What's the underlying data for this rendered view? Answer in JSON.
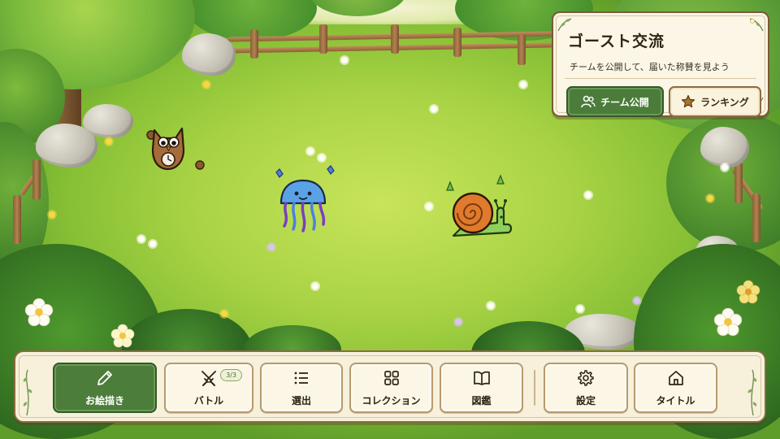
{
  "ghost_panel": {
    "title": "ゴースト交流",
    "subtitle": "チームを公開して、届いた称賛を見よう",
    "team_button_label": "チーム公開",
    "ranking_button_label": "ランキング"
  },
  "nav": {
    "draw_label": "お絵描き",
    "battle_label": "バトル",
    "battle_badge": "3/3",
    "select_label": "選出",
    "collection_label": "コレクション",
    "encyclopedia_label": "図鑑",
    "settings_label": "設定",
    "title_label": "タイトル"
  },
  "colors": {
    "accent_green": "#4d7d3b",
    "panel_cream": "#f7f0da",
    "frame_brown": "#8a6a42"
  },
  "icons": [
    "pencil-icon",
    "crossed-swords-icon",
    "list-icon",
    "grid-icon",
    "book-icon",
    "gear-icon",
    "home-icon",
    "people-icon",
    "star-icon"
  ]
}
